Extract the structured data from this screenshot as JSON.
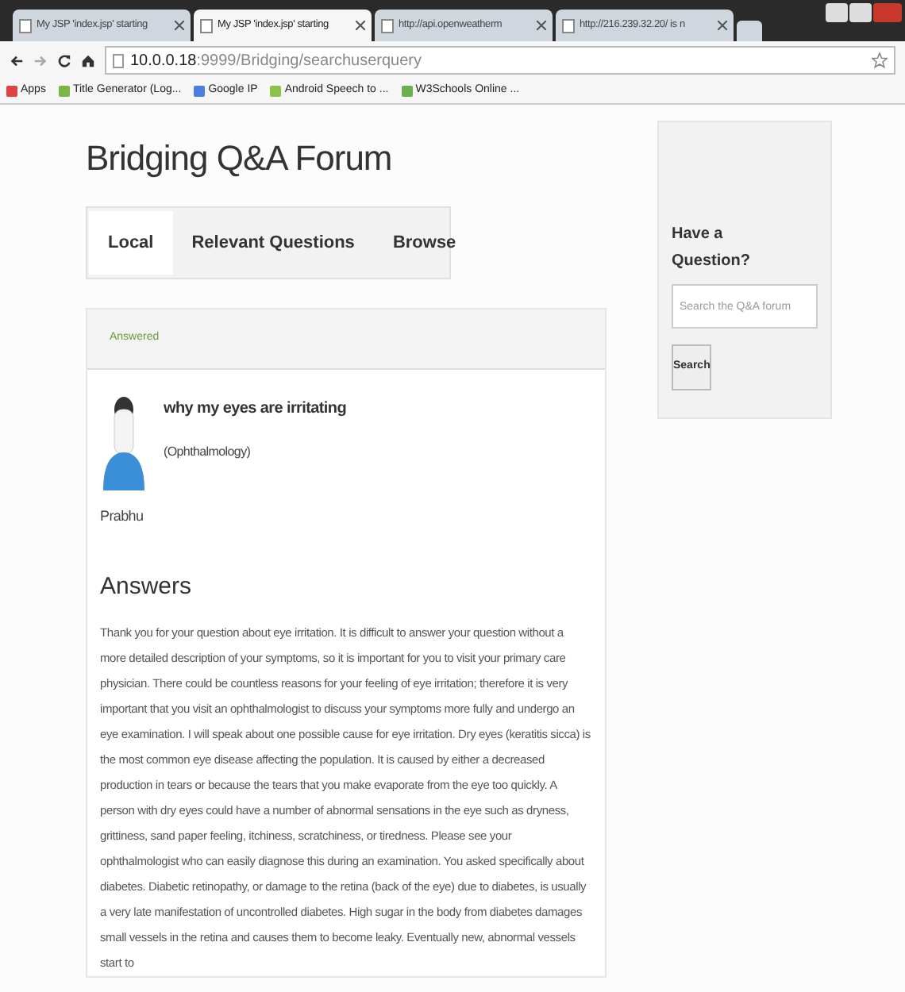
{
  "browser": {
    "tabs": [
      {
        "title": "My JSP 'index.jsp' starting",
        "selected": false
      },
      {
        "title": "My JSP 'index.jsp' starting",
        "selected": true
      },
      {
        "title": "http://api.openweatherm",
        "selected": false
      },
      {
        "title": "http://216.239.32.20/ is n",
        "selected": false
      }
    ],
    "address": {
      "host": "10.0.0.18",
      "path": ":9999/Bridging/searchuserquery"
    },
    "bookmarks": [
      "Apps",
      "Title Generator (Log...",
      "Google IP",
      "Android Speech to ...",
      "W3Schools Online ..."
    ]
  },
  "page": {
    "title": "Bridging Q&A Forum",
    "nav_tabs": [
      {
        "label": "Local",
        "selected": true
      },
      {
        "label": "Relevant Questions",
        "selected": false
      },
      {
        "label": "Browse",
        "selected": false
      }
    ],
    "question": {
      "status": "Answered",
      "title": "why my eyes are irritating",
      "category": "(Ophthalmology)",
      "author": "Prabhu"
    },
    "answers_heading": "Answers",
    "answer": "Thank you for your question about eye irritation. It is difficult to answer your question without a more detailed description of your symptoms, so it is important for you to visit your primary care physician. There could be countless reasons for your feeling of eye irritation; therefore it is very important that you visit an ophthalmologist to discuss your symptoms more fully and undergo an eye examination. I will speak about one possible cause for eye irritation. Dry eyes (keratitis sicca) is the most common eye disease affecting the population. It is caused by either a decreased production in tears or because the tears that you make evaporate from the eye too quickly. A person with dry eyes could have a number of abnormal sensations in the eye such as dryness, grittiness, sand paper feeling, itchiness, scratchiness, or tiredness. Please see your ophthalmologist who can easily diagnose this during an examination. You asked specifically about diabetes. Diabetic retinopathy, or damage to the retina (back of the eye) due to diabetes, is usually a very late manifestation of uncontrolled diabetes. High sugar in the body from diabetes damages small vessels in the retina and causes them to become leaky. Eventually new, abnormal vessels start to"
  },
  "sidebar": {
    "heading": "Have a Question?",
    "search_placeholder": "Search the Q&A forum",
    "button": "Search"
  }
}
